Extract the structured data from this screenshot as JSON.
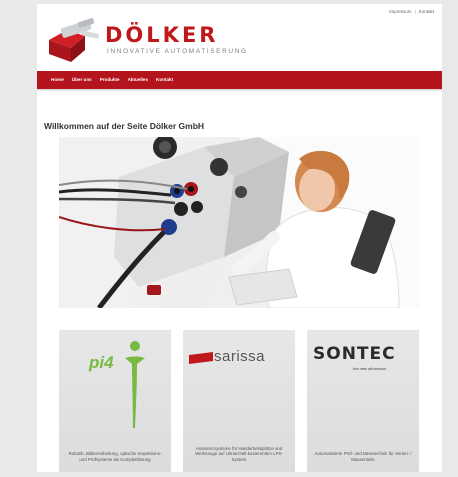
{
  "topbar": {
    "links": [
      "Impressum",
      "Kontakt"
    ]
  },
  "brand": {
    "name": "DÖLKER",
    "tagline": "INNOVATIVE AUTOMATISERUNG"
  },
  "nav": {
    "items": [
      "Home",
      "Über uns",
      "Produkte",
      "Aktuelles",
      "Kontakt"
    ]
  },
  "main": {
    "heading": "Willkommen auf der Seite Dölker GmbH"
  },
  "tiles": [
    {
      "logo": "pi4",
      "caption": "Robotik, Bildverarbeitung, optische Inspektions- und Prüfsysteme als Komplettlösung"
    },
    {
      "logo": "sarissa",
      "caption": "Assistenzsysteme für Handarbeitsplätze und Werkzeuge auf Ultraschall-basierenden LPS-System"
    },
    {
      "logo": "SONTEC",
      "tagline": "the new dimension",
      "caption": "Automatisierte Prüf- und Messtechnik für Serien- / Massenteile"
    }
  ],
  "colors": {
    "brand_red": "#c0171a",
    "nav_red": "#b4141b",
    "pi4_green": "#76b943"
  }
}
